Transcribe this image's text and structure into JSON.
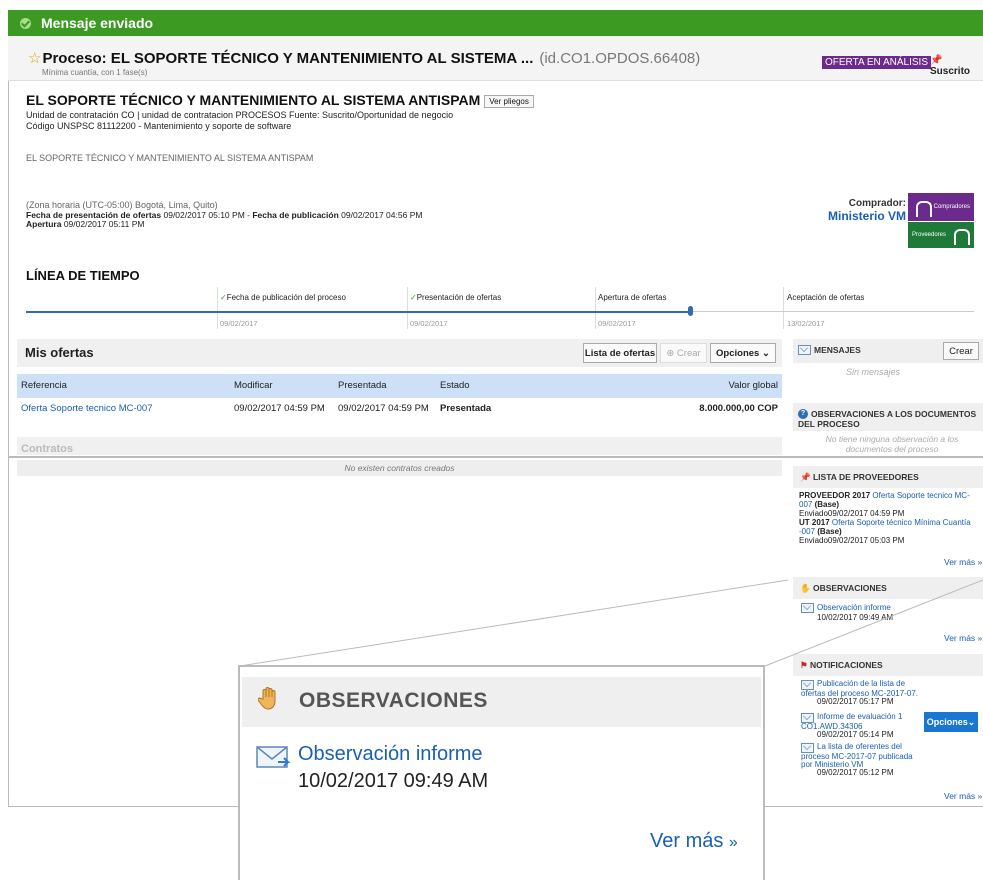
{
  "banner": {
    "text": "Mensaje enviado"
  },
  "process": {
    "title": "Proceso: EL SOPORTE TÉCNICO Y MANTENIMIENTO AL SISTEMA ...",
    "id": "(id.CO1.OPDOS.66408)",
    "subtitle": "Mínima cuantía, con 1 fase(s)",
    "status_badge": "OFERTA EN ANÁLISIS",
    "subscribed": "Suscrito",
    "name": "EL SOPORTE TÉCNICO Y MANTENIMIENTO AL SISTEMA ANTISPAM",
    "ver_pliegos": "Ver pliegos",
    "unidad": "Unidad de contratación CO | unidad de contratacion PROCESOS Fuente: Suscrito/Oportunidad de negocio",
    "unspsc": "Código UNSPSC 81112200 - Mantenimiento y soporte de software",
    "description": "EL SOPORTE TÉCNICO Y MANTENIMIENTO AL SISTEMA ANTISPAM",
    "timezone": "(Zona horaria (UTC-05:00) Bogotá, Lima, Quito)",
    "fecha_presentacion_label": "Fecha de presentación de ofertas",
    "fecha_presentacion": "09/02/2017 05:10 PM",
    "fecha_publicacion_label": "Fecha de publicación",
    "fecha_publicacion": "09/02/2017 04:56 PM",
    "apertura_label": "Apertura",
    "apertura": "09/02/2017 05:11 PM",
    "buyer_label": "Comprador:",
    "buyer_name": "Ministerio VM",
    "logo_top": "Compradores",
    "logo_bottom": "Proveedores"
  },
  "timeline": {
    "title": "LÍNEA DE TIEMPO",
    "steps": [
      {
        "label": "Fecha de publicación del proceso",
        "date": "09/02/2017",
        "done": true
      },
      {
        "label": "Presentación de ofertas",
        "date": "09/02/2017",
        "done": true
      },
      {
        "label": "Apertura de ofertas",
        "date": "09/02/2017",
        "done": false
      },
      {
        "label": "Aceptación de ofertas",
        "date": "13/02/2017",
        "done": false
      }
    ]
  },
  "ofertas": {
    "title": "Mis ofertas",
    "btn_lista": "Lista de ofertas",
    "btn_crear": "Crear",
    "btn_opciones": "Opciones",
    "columns": [
      "Referencia",
      "Modificar",
      "Presentada",
      "Estado",
      "Valor global"
    ],
    "row": {
      "referencia": "Oferta Soporte tecnico MC-007",
      "modificar": "09/02/2017 04:59 PM",
      "presentada": "09/02/2017 04:59 PM",
      "estado": "Presentada",
      "valor": "8.000.000,00 COP"
    }
  },
  "contratos": {
    "title": "Contratos",
    "empty": "No existen contratos creados"
  },
  "sidebar": {
    "mensajes": {
      "title": "MENSAJES",
      "crear": "Crear",
      "empty": "Sin mensajes"
    },
    "observaciones_docs": {
      "title": "OBSERVACIONES A LOS DOCUMENTOS DEL PROCESO",
      "empty": "No tiene ninguna observación a los documentos del proceso"
    },
    "proveedores": {
      "title": "LISTA DE PROVEEDORES",
      "items": [
        {
          "name": "PROVEEDOR 2017",
          "link": "Oferta Soporte tecnico MC-007",
          "base": "(Base)",
          "sent": "Enviado09/02/2017 04:59 PM"
        },
        {
          "name": "UT 2017",
          "link": "Oferta Soporte técnico Mínima Cuantía -007",
          "base": "(Base)",
          "sent": "Enviado09/02/2017 05:03 PM"
        }
      ],
      "ver_mas": "Ver más »"
    },
    "observaciones": {
      "title": "OBSERVACIONES",
      "link": "Observación informe",
      "date": "10/02/2017 09:49 AM",
      "ver_mas": "Ver más »"
    },
    "notificaciones": {
      "title": "NOTIFICACIONES",
      "items": [
        {
          "text": "Publicación de la lista de ofertas del proceso MC-2017-07.",
          "date": "09/02/2017 05:17 PM"
        },
        {
          "text": "Informe de evaluación 1 CO1.AWD.34306",
          "date": "09/02/2017 05:14 PM"
        },
        {
          "text": "La lista de oferentes del proceso MC-2017-07 publicada por Ministerio VM",
          "date": "09/02/2017 05:12 PM"
        }
      ],
      "opciones": "Opciones",
      "ver_mas": "Ver más »"
    }
  },
  "zoom": {
    "title": "OBSERVACIONES",
    "link": "Observación informe",
    "date": "10/02/2017 09:49 AM",
    "ver_mas": "Ver más"
  }
}
